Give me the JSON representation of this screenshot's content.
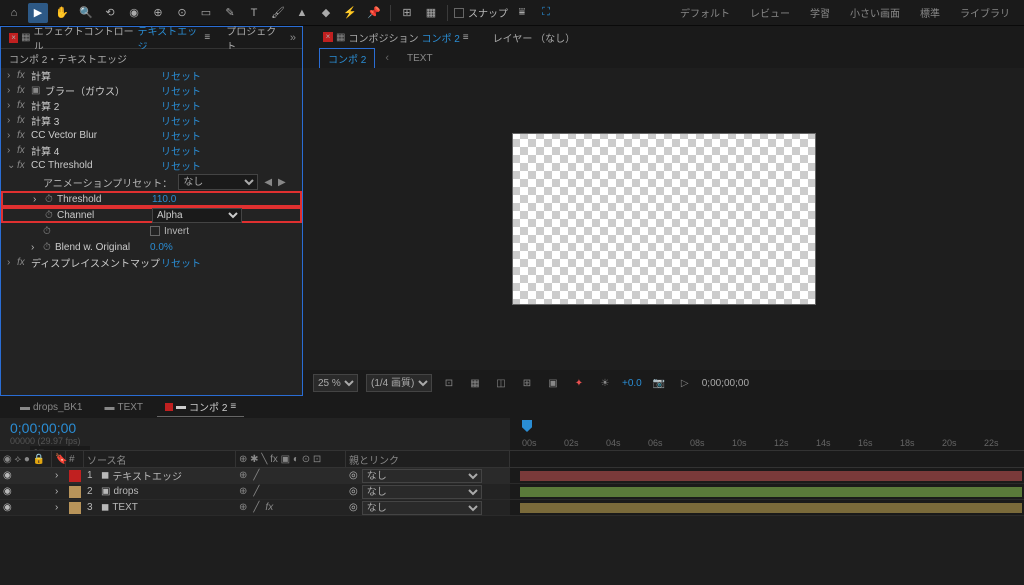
{
  "toolbar": {
    "snap_label": "スナップ",
    "workspaces": [
      "デフォルト",
      "レビュー",
      "学習",
      "小さい画面",
      "標準",
      "ライブラリ"
    ]
  },
  "effectsPanel": {
    "title": "エフェクトコントロール",
    "title_layer": "テキストエッジ",
    "project_tab": "プロジェクト",
    "subtitle": "コンポ 2・テキストエッジ",
    "reset_label": "リセット",
    "effects": [
      {
        "name": "計算"
      },
      {
        "name": "ブラー（ガウス）"
      },
      {
        "name": "計算 2"
      },
      {
        "name": "計算 3"
      },
      {
        "name": "CC Vector Blur"
      },
      {
        "name": "計算 4"
      }
    ],
    "threshold": {
      "name": "CC Threshold",
      "preset_label": "アニメーションプリセット：",
      "preset_val": "なし",
      "threshold_label": "Threshold",
      "threshold_val": "110.0",
      "channel_label": "Channel",
      "channel_val": "Alpha",
      "invert_label": "Invert",
      "blend_label": "Blend w. Original",
      "blend_val": "0.0%"
    },
    "displace": {
      "name": "ディスプレイスメントマップ"
    }
  },
  "compPanel": {
    "title": "コンポジション",
    "comp_name": "コンポ 2",
    "layer_tab": "レイヤー （なし）",
    "sub_tab1": "コンポ 2",
    "sub_tab2": "TEXT"
  },
  "viewerCtrl": {
    "zoom": "25 %",
    "quality": "(1/4 画質)",
    "exposure": "+0.0",
    "timecode": "0;00;00;00"
  },
  "timeline": {
    "tabs": [
      {
        "label": "drops_BK1",
        "active": false
      },
      {
        "label": "TEXT",
        "active": false
      },
      {
        "label": "コンポ 2",
        "active": true
      }
    ],
    "timecode": "0;00;00;00",
    "fps_label": "00000 (29.97 fps)",
    "search_placeholder": "ρ▾",
    "col_source": "ソース名",
    "col_parent": "親とリンク",
    "ticks": [
      "00s",
      "02s",
      "04s",
      "06s",
      "08s",
      "10s",
      "12s",
      "14s",
      "16s",
      "18s",
      "20s",
      "22s"
    ],
    "layers": [
      {
        "num": "1",
        "color": "#c02020",
        "name": "テキストエッジ",
        "icon": "◼",
        "parent": "なし",
        "bar": "#7a3a3a",
        "sel": true
      },
      {
        "num": "2",
        "color": "#b8945a",
        "name": "drops",
        "icon": "▣",
        "parent": "なし",
        "bar": "#5a7a3a",
        "sel": false
      },
      {
        "num": "3",
        "color": "#b8945a",
        "name": "TEXT",
        "icon": "◼",
        "parent": "なし",
        "bar": "#7a6a3a",
        "sel": false
      }
    ]
  }
}
